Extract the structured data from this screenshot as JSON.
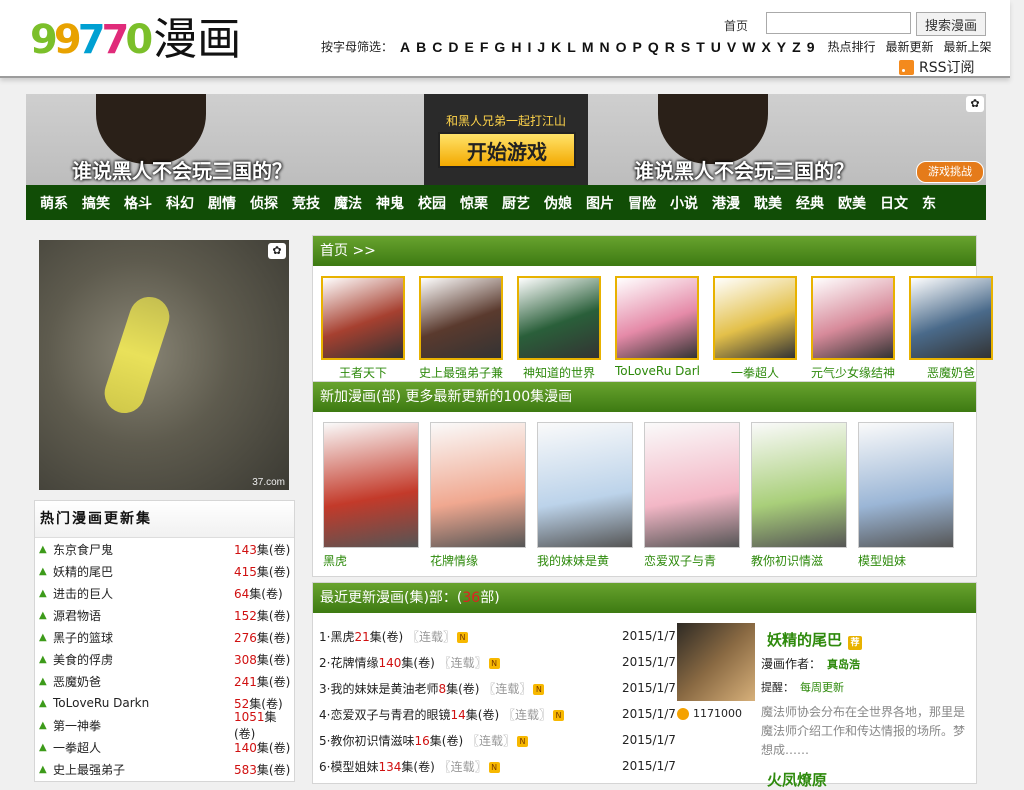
{
  "header": {
    "logo_digits": [
      "9",
      "9",
      "7",
      "7",
      "0"
    ],
    "logo_text": "漫画",
    "home_label": "首页",
    "search_placeholder": "",
    "search_button": "搜索漫画",
    "filter_label": "按字母筛选：",
    "letters": [
      "A",
      "B",
      "C",
      "D",
      "E",
      "F",
      "G",
      "H",
      "I",
      "J",
      "K",
      "L",
      "M",
      "N",
      "O",
      "P",
      "Q",
      "R",
      "S",
      "T",
      "U",
      "V",
      "W",
      "X",
      "Y",
      "Z",
      "9"
    ],
    "extra_links": [
      "热点排行",
      "最新更新",
      "最新上架"
    ],
    "rss_label": "RSS订阅"
  },
  "banner": {
    "slogan": "谁说黑人不会玩三国的？",
    "mid_text": "和黑人兄弟一起打江山",
    "play_button": "开始游戏",
    "prize_label": "游戏挑战"
  },
  "categories": [
    "萌系",
    "搞笑",
    "格斗",
    "科幻",
    "剧情",
    "侦探",
    "竞技",
    "魔法",
    "神鬼",
    "校园",
    "惊栗",
    "厨艺",
    "伪娘",
    "图片",
    "冒险",
    "小说",
    "港漫",
    "耽美",
    "经典",
    "欧美",
    "日文",
    "东"
  ],
  "left_ad": {
    "source": "37.com"
  },
  "hot": {
    "title": "热门漫画更新集",
    "unit": "集(卷)",
    "items": [
      {
        "name": "东京食尸鬼",
        "count": "143"
      },
      {
        "name": "妖精的尾巴",
        "count": "415"
      },
      {
        "name": "进击的巨人",
        "count": "64"
      },
      {
        "name": "源君物语",
        "count": "152"
      },
      {
        "name": "黑子的篮球",
        "count": "276"
      },
      {
        "name": "美食的俘虏",
        "count": "308"
      },
      {
        "name": "恶魔奶爸",
        "count": "241"
      },
      {
        "name": "ToLoveRu Darkn",
        "count": "52"
      },
      {
        "name": "第一神拳",
        "count": "1051"
      },
      {
        "name": "一拳超人",
        "count": "140"
      },
      {
        "name": "史上最强弟子",
        "count": "583"
      }
    ]
  },
  "home_panel": {
    "title": "首页 >>",
    "items": [
      {
        "name": "王者天下",
        "color": "#a64030"
      },
      {
        "name": "史上最强弟子兼一",
        "color": "#5a3a2e"
      },
      {
        "name": "神知道的世界",
        "color": "#2a5f3a"
      },
      {
        "name": "ToLoveRu Darkn",
        "color": "#e58aa8"
      },
      {
        "name": "一拳超人",
        "color": "#e3c04a"
      },
      {
        "name": "元气少女缘结神",
        "color": "#d78a9a"
      },
      {
        "name": "恶魔奶爸",
        "color": "#4a6a8a"
      }
    ]
  },
  "new_panel": {
    "title": "新加漫画(部) 更多最新更新的100集漫画",
    "items": [
      {
        "name": "黑虎",
        "color": "#c33a2a"
      },
      {
        "name": "花牌情缘",
        "color": "#f0a890"
      },
      {
        "name": "我的妹妹是黄",
        "color": "#bcd3ea"
      },
      {
        "name": "恋爱双子与青",
        "color": "#f3b7c6"
      },
      {
        "name": "教你初识情滋",
        "color": "#a9cf7a"
      },
      {
        "name": "模型姐妹",
        "color": "#9bb6d6"
      }
    ]
  },
  "recent_panel": {
    "title_prefix": "最近更新漫画(集)部：(",
    "count": "36",
    "title_suffix": "部)",
    "unit": "集(卷)",
    "status": "〖连载〗",
    "items": [
      {
        "idx": "1",
        "name": "黑虎",
        "num": "21",
        "date": "2015/1/7"
      },
      {
        "idx": "2",
        "name": "花牌情缘",
        "num": "140",
        "date": "2015/1/7"
      },
      {
        "idx": "3",
        "name": "我的妹妹是黄油老师",
        "num": "8",
        "date": "2015/1/7"
      },
      {
        "idx": "4",
        "name": "恋爱双子与青君的眼镜",
        "num": "14",
        "date": "2015/1/7"
      },
      {
        "idx": "5",
        "name": "教你初识情滋味",
        "num": "16",
        "date": "2015/1/7"
      },
      {
        "idx": "6",
        "name": "模型姐妹",
        "num": "134",
        "date": "2015/1/7"
      }
    ],
    "feature": {
      "name": "妖精的尾巴",
      "tag": "荐",
      "author_label": "漫画作者：",
      "author": "真岛浩",
      "remind_label": "提醒：",
      "remind": "每周更新",
      "desc": "魔法师协会分布在全世界各地，那里是魔法师介绍工作和传达情报的场所。梦想成……",
      "hits": "1171000",
      "next_name": "火凤燎原"
    }
  }
}
